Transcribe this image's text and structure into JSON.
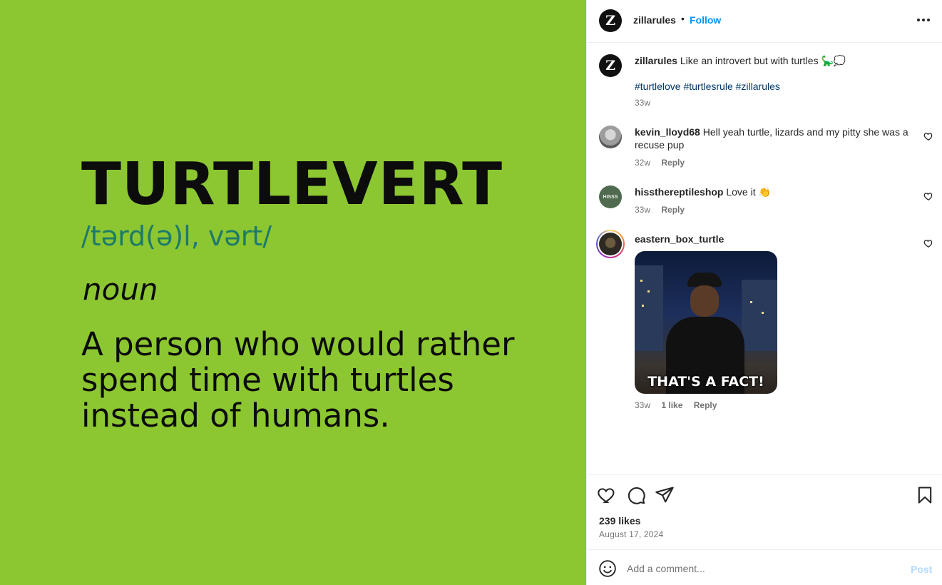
{
  "media": {
    "word": "TURTLEVERT",
    "phonetic": "/tərd(ə)l, vərt/",
    "part_of_speech": "noun",
    "definition": "A person who would rather spend time with turtles instead of humans.",
    "background_color": "#8cc731",
    "phonetic_color": "#1d7a6a"
  },
  "header": {
    "avatar_letter": "Z",
    "username": "zillarules",
    "separator": "•",
    "follow_label": "Follow",
    "more_icon": "more-horizontal-icon"
  },
  "caption": {
    "username": "zillarules",
    "text": "Like an introvert but with turtles 🦕💭",
    "hashtags": "#turtlelove #turtlesrule #zillarules",
    "time": "33w"
  },
  "comments": [
    {
      "username": "kevin_lloyd68",
      "text": "Hell yeah turtle, lizards and my pitty she was a recuse pup",
      "time": "32w",
      "reply_label": "Reply"
    },
    {
      "username": "hissthereptileshop",
      "avatar_text": "HISSS",
      "text": "Love it 👏",
      "time": "33w",
      "reply_label": "Reply"
    },
    {
      "username": "eastern_box_turtle",
      "gif_caption": "THAT'S A FACT!",
      "time": "33w",
      "likes_label": "1 like",
      "reply_label": "Reply"
    }
  ],
  "actions": {
    "likes": "239 likes",
    "date": "August 17, 2024"
  },
  "add_comment": {
    "placeholder": "Add a comment...",
    "post_label": "Post"
  },
  "colors": {
    "link_blue": "#0095f6",
    "hashtag_blue": "#00376b",
    "muted_text": "#737373",
    "post_disabled": "#b3dbff"
  }
}
